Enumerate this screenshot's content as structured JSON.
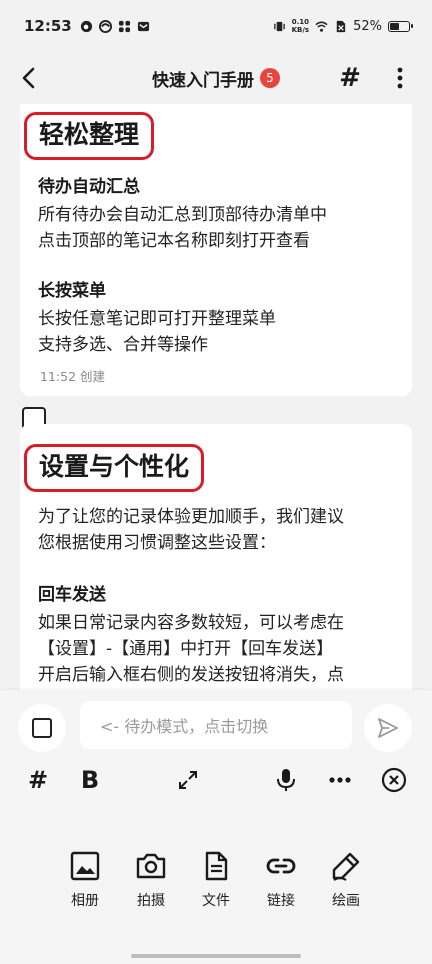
{
  "status_bar": {
    "time": "12:53",
    "net_speed_value": "0.10",
    "net_speed_unit": "KB/s",
    "battery": "52%",
    "battery_level": 0.52
  },
  "header": {
    "title": "快速入门手册",
    "badge_count": "5"
  },
  "notes": [
    {
      "heading": "轻松整理",
      "sections": [
        {
          "title": "待办自动汇总",
          "lines": [
            "所有待办会自动汇总到顶部待办清单中",
            "点击顶部的笔记本名称即刻打开查看"
          ]
        },
        {
          "title": "长按菜单",
          "lines": [
            "长按任意笔记即可打开整理菜单",
            "支持多选、合并等操作"
          ]
        }
      ],
      "time": "11:52 创建"
    },
    {
      "heading": "设置与个性化",
      "intro": [
        "为了让您的记录体验更加顺手，我们建议",
        "您根据使用习惯调整这些设置："
      ],
      "sections": [
        {
          "title": "回车发送",
          "lines": [
            "如果日常记录内容多数较短，可以考虑在",
            "【设置】-【通用】中打开【回车发送】",
            "开启后输入框右侧的发送按钮将消失，点"
          ]
        }
      ]
    }
  ],
  "composer": {
    "placeholder": "<- 待办模式，点击切换"
  },
  "toolbar": {
    "hash": "#",
    "bold": "B"
  },
  "media": {
    "album": "相册",
    "camera": "拍摄",
    "file": "文件",
    "link": "链接",
    "draw": "绘画"
  },
  "colors": {
    "highlight_border": "#d61e2a",
    "badge": "#e8453c"
  }
}
